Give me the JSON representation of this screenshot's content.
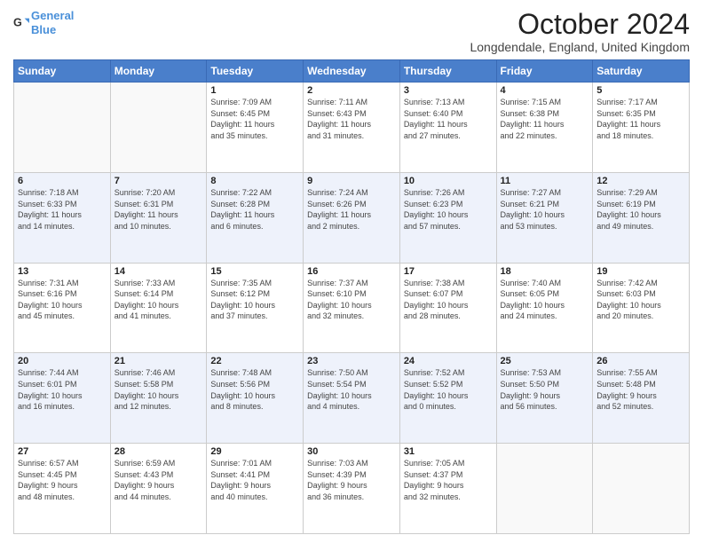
{
  "header": {
    "logo_line1": "General",
    "logo_line2": "Blue",
    "month": "October 2024",
    "location": "Longdendale, England, United Kingdom"
  },
  "weekdays": [
    "Sunday",
    "Monday",
    "Tuesday",
    "Wednesday",
    "Thursday",
    "Friday",
    "Saturday"
  ],
  "weeks": [
    [
      {
        "day": "",
        "info": ""
      },
      {
        "day": "",
        "info": ""
      },
      {
        "day": "1",
        "info": "Sunrise: 7:09 AM\nSunset: 6:45 PM\nDaylight: 11 hours\nand 35 minutes."
      },
      {
        "day": "2",
        "info": "Sunrise: 7:11 AM\nSunset: 6:43 PM\nDaylight: 11 hours\nand 31 minutes."
      },
      {
        "day": "3",
        "info": "Sunrise: 7:13 AM\nSunset: 6:40 PM\nDaylight: 11 hours\nand 27 minutes."
      },
      {
        "day": "4",
        "info": "Sunrise: 7:15 AM\nSunset: 6:38 PM\nDaylight: 11 hours\nand 22 minutes."
      },
      {
        "day": "5",
        "info": "Sunrise: 7:17 AM\nSunset: 6:35 PM\nDaylight: 11 hours\nand 18 minutes."
      }
    ],
    [
      {
        "day": "6",
        "info": "Sunrise: 7:18 AM\nSunset: 6:33 PM\nDaylight: 11 hours\nand 14 minutes."
      },
      {
        "day": "7",
        "info": "Sunrise: 7:20 AM\nSunset: 6:31 PM\nDaylight: 11 hours\nand 10 minutes."
      },
      {
        "day": "8",
        "info": "Sunrise: 7:22 AM\nSunset: 6:28 PM\nDaylight: 11 hours\nand 6 minutes."
      },
      {
        "day": "9",
        "info": "Sunrise: 7:24 AM\nSunset: 6:26 PM\nDaylight: 11 hours\nand 2 minutes."
      },
      {
        "day": "10",
        "info": "Sunrise: 7:26 AM\nSunset: 6:23 PM\nDaylight: 10 hours\nand 57 minutes."
      },
      {
        "day": "11",
        "info": "Sunrise: 7:27 AM\nSunset: 6:21 PM\nDaylight: 10 hours\nand 53 minutes."
      },
      {
        "day": "12",
        "info": "Sunrise: 7:29 AM\nSunset: 6:19 PM\nDaylight: 10 hours\nand 49 minutes."
      }
    ],
    [
      {
        "day": "13",
        "info": "Sunrise: 7:31 AM\nSunset: 6:16 PM\nDaylight: 10 hours\nand 45 minutes."
      },
      {
        "day": "14",
        "info": "Sunrise: 7:33 AM\nSunset: 6:14 PM\nDaylight: 10 hours\nand 41 minutes."
      },
      {
        "day": "15",
        "info": "Sunrise: 7:35 AM\nSunset: 6:12 PM\nDaylight: 10 hours\nand 37 minutes."
      },
      {
        "day": "16",
        "info": "Sunrise: 7:37 AM\nSunset: 6:10 PM\nDaylight: 10 hours\nand 32 minutes."
      },
      {
        "day": "17",
        "info": "Sunrise: 7:38 AM\nSunset: 6:07 PM\nDaylight: 10 hours\nand 28 minutes."
      },
      {
        "day": "18",
        "info": "Sunrise: 7:40 AM\nSunset: 6:05 PM\nDaylight: 10 hours\nand 24 minutes."
      },
      {
        "day": "19",
        "info": "Sunrise: 7:42 AM\nSunset: 6:03 PM\nDaylight: 10 hours\nand 20 minutes."
      }
    ],
    [
      {
        "day": "20",
        "info": "Sunrise: 7:44 AM\nSunset: 6:01 PM\nDaylight: 10 hours\nand 16 minutes."
      },
      {
        "day": "21",
        "info": "Sunrise: 7:46 AM\nSunset: 5:58 PM\nDaylight: 10 hours\nand 12 minutes."
      },
      {
        "day": "22",
        "info": "Sunrise: 7:48 AM\nSunset: 5:56 PM\nDaylight: 10 hours\nand 8 minutes."
      },
      {
        "day": "23",
        "info": "Sunrise: 7:50 AM\nSunset: 5:54 PM\nDaylight: 10 hours\nand 4 minutes."
      },
      {
        "day": "24",
        "info": "Sunrise: 7:52 AM\nSunset: 5:52 PM\nDaylight: 10 hours\nand 0 minutes."
      },
      {
        "day": "25",
        "info": "Sunrise: 7:53 AM\nSunset: 5:50 PM\nDaylight: 9 hours\nand 56 minutes."
      },
      {
        "day": "26",
        "info": "Sunrise: 7:55 AM\nSunset: 5:48 PM\nDaylight: 9 hours\nand 52 minutes."
      }
    ],
    [
      {
        "day": "27",
        "info": "Sunrise: 6:57 AM\nSunset: 4:45 PM\nDaylight: 9 hours\nand 48 minutes."
      },
      {
        "day": "28",
        "info": "Sunrise: 6:59 AM\nSunset: 4:43 PM\nDaylight: 9 hours\nand 44 minutes."
      },
      {
        "day": "29",
        "info": "Sunrise: 7:01 AM\nSunset: 4:41 PM\nDaylight: 9 hours\nand 40 minutes."
      },
      {
        "day": "30",
        "info": "Sunrise: 7:03 AM\nSunset: 4:39 PM\nDaylight: 9 hours\nand 36 minutes."
      },
      {
        "day": "31",
        "info": "Sunrise: 7:05 AM\nSunset: 4:37 PM\nDaylight: 9 hours\nand 32 minutes."
      },
      {
        "day": "",
        "info": ""
      },
      {
        "day": "",
        "info": ""
      }
    ]
  ]
}
